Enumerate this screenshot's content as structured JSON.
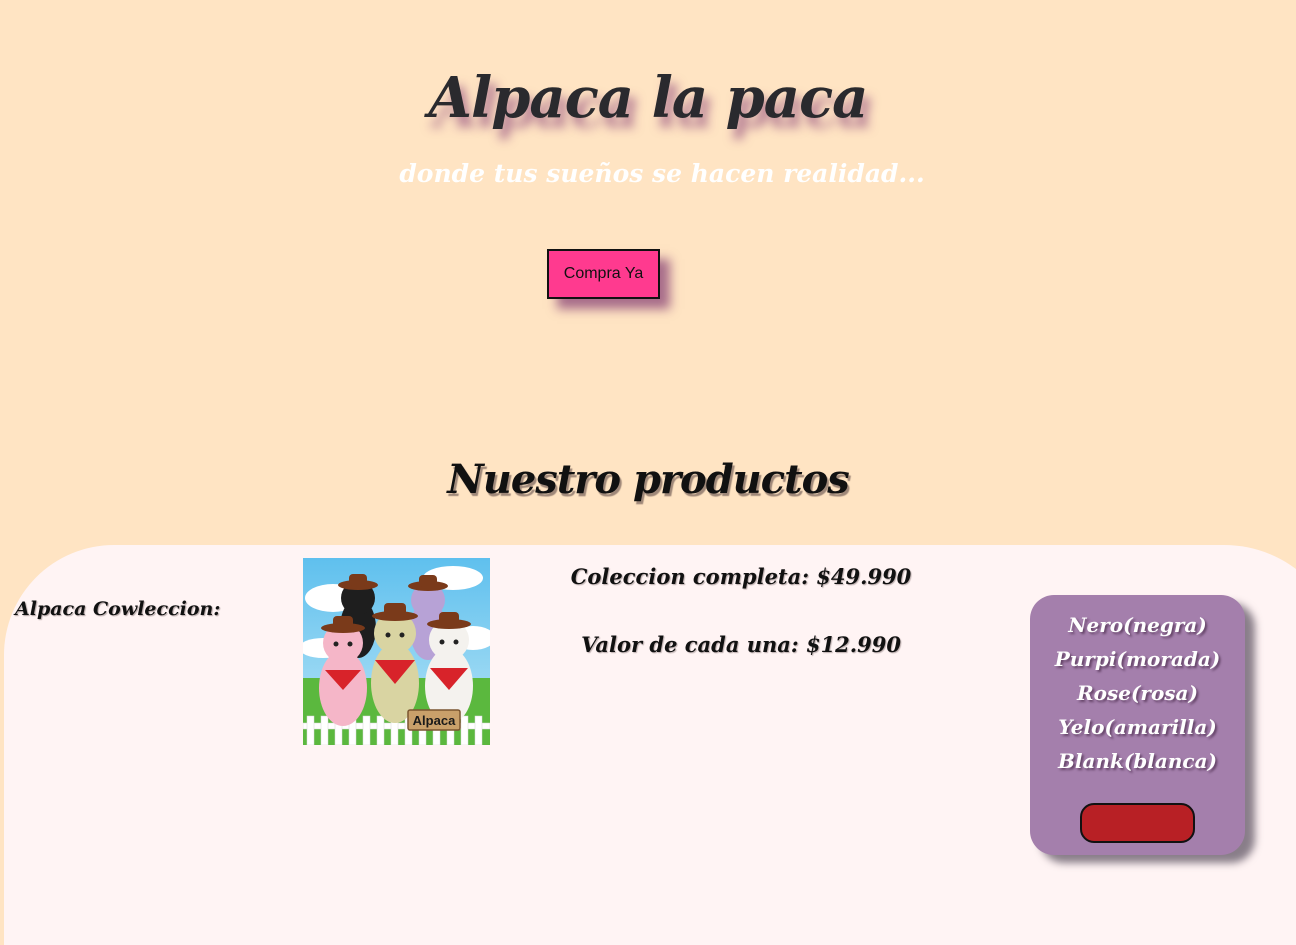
{
  "hero": {
    "title": "Alpaca la paca",
    "subtitle": "donde tus sueños se hacen realidad...",
    "cta_label": "Compra Ya"
  },
  "products": {
    "heading": "Nuestro productos",
    "item": {
      "name": "Alpaca Cowleccion:",
      "image_sign": "Alpaca",
      "price_full": "Coleccion completa: $49.990",
      "price_each": "Valor de cada una: $12.990",
      "colors": [
        "Nero(negra)",
        "Purpi(morada)",
        "Rose(rosa)",
        "Yelo(amarilla)",
        "Blank(blanca)"
      ]
    }
  },
  "theme": {
    "page_bg": "#ffe4c3",
    "panel_bg": "#fff4f4",
    "cta_color": "#ff3a8f",
    "card_color": "#a47fac",
    "card_button_color": "#b82025"
  }
}
